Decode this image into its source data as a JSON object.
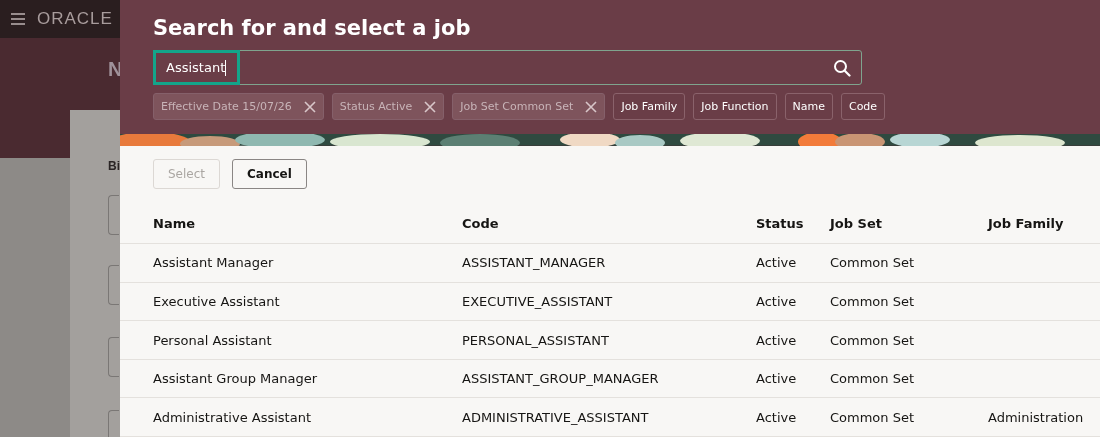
{
  "background_page": {
    "brand": "ORACLE",
    "heading": "N",
    "section_label": "Bi"
  },
  "dialog": {
    "title": "Search for and select a job",
    "search": {
      "value": "Assistant"
    },
    "chips": [
      {
        "kind": "filter",
        "label": "Effective Date 15/07/26"
      },
      {
        "kind": "filter",
        "label": "Status Active"
      },
      {
        "kind": "filter",
        "label": "Job Set Common Set"
      },
      {
        "kind": "option",
        "label": "Job Family"
      },
      {
        "kind": "option",
        "label": "Job Function"
      },
      {
        "kind": "option",
        "label": "Name"
      },
      {
        "kind": "option",
        "label": "Code"
      }
    ],
    "buttons": [
      {
        "label": "Select",
        "disabled": true
      },
      {
        "label": "Cancel",
        "disabled": false
      }
    ],
    "table": {
      "columns": [
        "Name",
        "Code",
        "Status",
        "Job Set",
        "Job Family"
      ],
      "rows": [
        [
          "Assistant Manager",
          "ASSISTANT_MANAGER",
          "Active",
          "Common Set",
          ""
        ],
        [
          "Executive Assistant",
          "EXECUTIVE_ASSISTANT",
          "Active",
          "Common Set",
          ""
        ],
        [
          "Personal Assistant",
          "PERSONAL_ASSISTANT",
          "Active",
          "Common Set",
          ""
        ],
        [
          "Assistant Group Manager",
          "ASSISTANT_GROUP_MANAGER",
          "Active",
          "Common Set",
          ""
        ],
        [
          "Administrative Assistant",
          "ADMINISTRATIVE_ASSISTANT",
          "Active",
          "Common Set",
          "Administration"
        ]
      ]
    }
  }
}
